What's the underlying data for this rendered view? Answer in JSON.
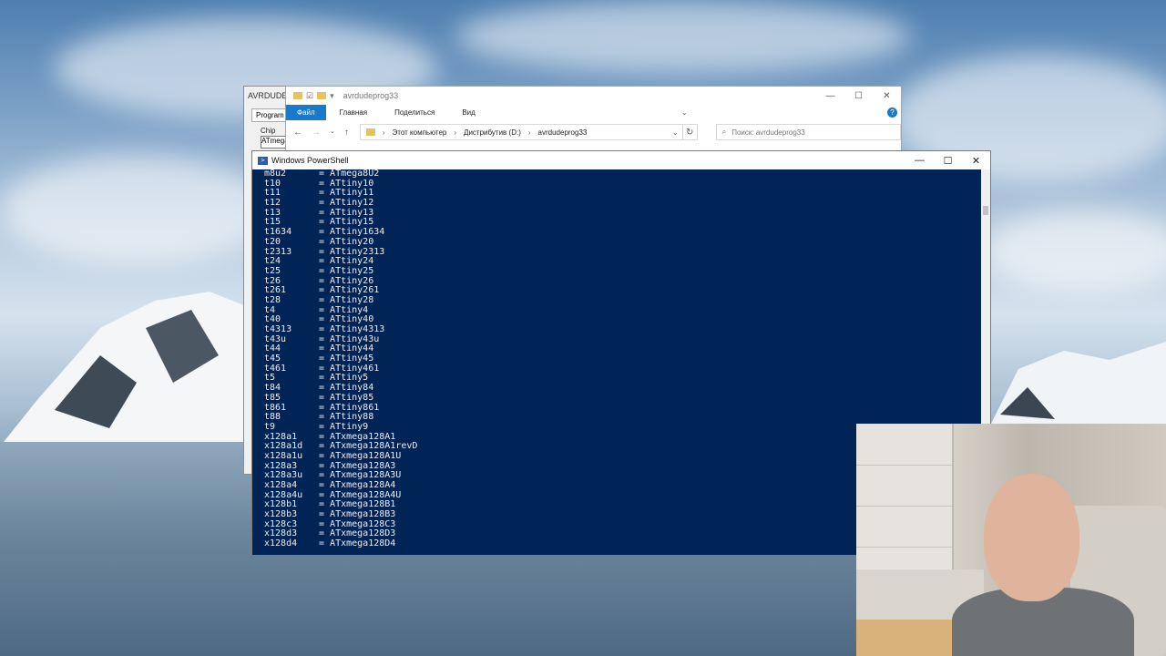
{
  "avrdude": {
    "title": "AVRDUDE",
    "tab": "Program",
    "chip_label": "Chip",
    "chip_value": "ATmega"
  },
  "explorer": {
    "title": "avrdudeprog33",
    "tabs": [
      "Файл",
      "Главная",
      "Поделиться",
      "Вид"
    ],
    "breadcrumb": [
      "Этот компьютер",
      "Дистрибутив (D:)",
      "avrdudeprog33"
    ],
    "search_placeholder": "Поиск: avrdudeprog33"
  },
  "powershell": {
    "title": "Windows PowerShell",
    "lines": [
      {
        "code": "m8u2",
        "name": "ATmega8U2"
      },
      {
        "code": "t10",
        "name": "ATtiny10"
      },
      {
        "code": "t11",
        "name": "ATtiny11"
      },
      {
        "code": "t12",
        "name": "ATtiny12"
      },
      {
        "code": "t13",
        "name": "ATtiny13"
      },
      {
        "code": "t15",
        "name": "ATtiny15"
      },
      {
        "code": "t1634",
        "name": "ATtiny1634"
      },
      {
        "code": "t20",
        "name": "ATtiny20"
      },
      {
        "code": "t2313",
        "name": "ATtiny2313"
      },
      {
        "code": "t24",
        "name": "ATtiny24"
      },
      {
        "code": "t25",
        "name": "ATtiny25"
      },
      {
        "code": "t26",
        "name": "ATtiny26"
      },
      {
        "code": "t261",
        "name": "ATtiny261"
      },
      {
        "code": "t28",
        "name": "ATtiny28"
      },
      {
        "code": "t4",
        "name": "ATtiny4"
      },
      {
        "code": "t40",
        "name": "ATtiny40"
      },
      {
        "code": "t4313",
        "name": "ATtiny4313"
      },
      {
        "code": "t43u",
        "name": "ATtiny43u"
      },
      {
        "code": "t44",
        "name": "ATtiny44"
      },
      {
        "code": "t45",
        "name": "ATtiny45"
      },
      {
        "code": "t461",
        "name": "ATtiny461"
      },
      {
        "code": "t5",
        "name": "ATtiny5"
      },
      {
        "code": "t84",
        "name": "ATtiny84"
      },
      {
        "code": "t85",
        "name": "ATtiny85"
      },
      {
        "code": "t861",
        "name": "ATtiny861"
      },
      {
        "code": "t88",
        "name": "ATtiny88"
      },
      {
        "code": "t9",
        "name": "ATtiny9"
      },
      {
        "code": "x128a1",
        "name": "ATxmega128A1"
      },
      {
        "code": "x128a1d",
        "name": "ATxmega128A1revD"
      },
      {
        "code": "x128a1u",
        "name": "ATxmega128A1U"
      },
      {
        "code": "x128a3",
        "name": "ATxmega128A3"
      },
      {
        "code": "x128a3u",
        "name": "ATxmega128A3U"
      },
      {
        "code": "x128a4",
        "name": "ATxmega128A4"
      },
      {
        "code": "x128a4u",
        "name": "ATxmega128A4U"
      },
      {
        "code": "x128b1",
        "name": "ATxmega128B1"
      },
      {
        "code": "x128b3",
        "name": "ATxmega128B3"
      },
      {
        "code": "x128c3",
        "name": "ATxmega128C3"
      },
      {
        "code": "x128d3",
        "name": "ATxmega128D3"
      },
      {
        "code": "x128d4",
        "name": "ATxmega128D4"
      }
    ]
  },
  "icons": {
    "ps_icon": "powershell-icon",
    "folder": "folder-icon",
    "search": "search-icon"
  },
  "colors": {
    "ps_background": "#012456",
    "ps_text": "#eeedf0",
    "ribbon_accent": "#1979ca"
  }
}
